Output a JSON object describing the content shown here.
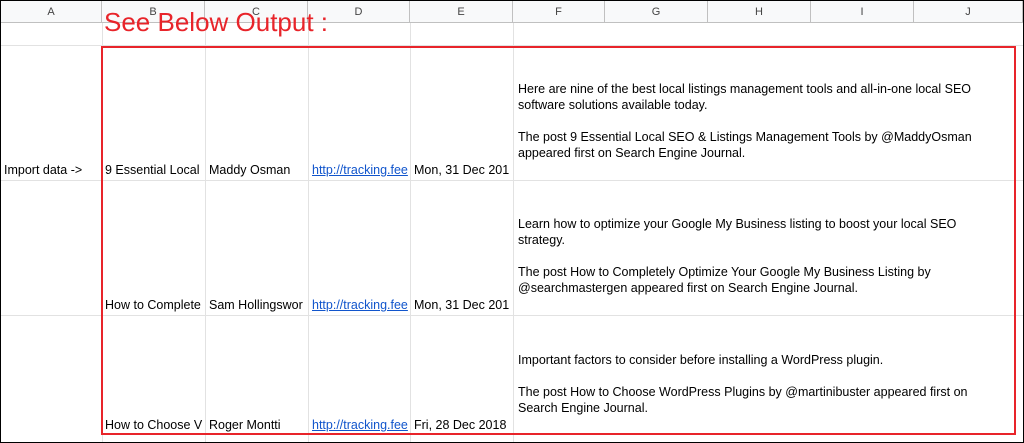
{
  "annotation": "See Below Output :",
  "columns": [
    "A",
    "B",
    "C",
    "D",
    "E",
    "F",
    "G",
    "H",
    "I",
    "J"
  ],
  "label_cell": "Import data ->",
  "rows": [
    {
      "title": "9 Essential Local",
      "author": "Maddy Osman",
      "link": "http://tracking.fee",
      "date": "Mon, 31 Dec 201",
      "desc_1": "Here are nine of the best local listings management tools and all-in-one local SEO software solutions available today.",
      "desc_2": "The post 9 Essential Local SEO & Listings Management Tools by @MaddyOsman appeared first on Search Engine Journal."
    },
    {
      "title": "How to Complete",
      "author": "Sam Hollingswor",
      "link": "http://tracking.fee",
      "date": "Mon, 31 Dec 201",
      "desc_1": "Learn how to optimize your Google My Business listing to boost your local SEO strategy.",
      "desc_2": "The post How to Completely Optimize Your Google My Business Listing by @searchmastergen appeared first on Search Engine Journal."
    },
    {
      "title": "How to Choose V",
      "author": "Roger Montti",
      "link": "http://tracking.fee",
      "date": "Fri, 28 Dec 2018",
      "desc_1": "Important factors to consider before installing a WordPress plugin.",
      "desc_2": "The post How to Choose WordPress Plugins by @martinibuster appeared first on Search Engine Journal."
    }
  ]
}
